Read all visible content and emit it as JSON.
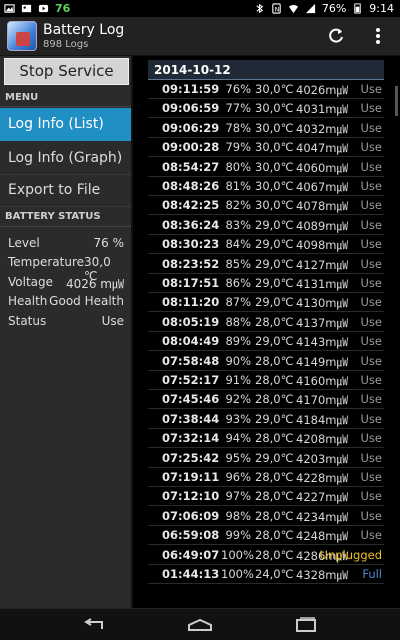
{
  "status_bar": {
    "left_number": "76",
    "battery_percent": "76%",
    "time": "9:14"
  },
  "header": {
    "title": "Battery Log",
    "subtitle": "898 Logs",
    "icons": [
      "refresh-icon",
      "overflow-menu-icon"
    ]
  },
  "drawer": {
    "stop_button": "Stop Service",
    "menu_heading": "MENU",
    "menu_items": [
      {
        "label": "Log Info (List)",
        "active": true
      },
      {
        "label": "Log Info (Graph)",
        "active": false
      },
      {
        "label": "Export to File",
        "active": false
      }
    ],
    "status_heading": "BATTERY STATUS",
    "status": [
      {
        "label": "Level",
        "value": "76 %"
      },
      {
        "label": "Temperature",
        "value": "30,0 ℃"
      },
      {
        "label": "Voltage",
        "value": "4026 m㎼"
      },
      {
        "label": "Health",
        "value": "Good Health"
      },
      {
        "label": "Status",
        "value": "Use"
      }
    ]
  },
  "log": {
    "date": "2014-10-12",
    "rows": [
      {
        "time": "09:11:59",
        "pct": "76%",
        "temp": "30,0℃",
        "volt": "4026m㎼",
        "status": "Use"
      },
      {
        "time": "09:06:59",
        "pct": "77%",
        "temp": "30,0℃",
        "volt": "4031m㎼",
        "status": "Use"
      },
      {
        "time": "09:06:29",
        "pct": "78%",
        "temp": "30,0℃",
        "volt": "4032m㎼",
        "status": "Use"
      },
      {
        "time": "09:00:28",
        "pct": "79%",
        "temp": "30,0℃",
        "volt": "4047m㎼",
        "status": "Use"
      },
      {
        "time": "08:54:27",
        "pct": "80%",
        "temp": "30,0℃",
        "volt": "4060m㎼",
        "status": "Use"
      },
      {
        "time": "08:48:26",
        "pct": "81%",
        "temp": "30,0℃",
        "volt": "4067m㎼",
        "status": "Use"
      },
      {
        "time": "08:42:25",
        "pct": "82%",
        "temp": "30,0℃",
        "volt": "4078m㎼",
        "status": "Use"
      },
      {
        "time": "08:36:24",
        "pct": "83%",
        "temp": "29,0℃",
        "volt": "4089m㎼",
        "status": "Use"
      },
      {
        "time": "08:30:23",
        "pct": "84%",
        "temp": "29,0℃",
        "volt": "4098m㎼",
        "status": "Use"
      },
      {
        "time": "08:23:52",
        "pct": "85%",
        "temp": "29,0℃",
        "volt": "4127m㎼",
        "status": "Use"
      },
      {
        "time": "08:17:51",
        "pct": "86%",
        "temp": "29,0℃",
        "volt": "4131m㎼",
        "status": "Use"
      },
      {
        "time": "08:11:20",
        "pct": "87%",
        "temp": "29,0℃",
        "volt": "4130m㎼",
        "status": "Use"
      },
      {
        "time": "08:05:19",
        "pct": "88%",
        "temp": "28,0℃",
        "volt": "4137m㎼",
        "status": "Use"
      },
      {
        "time": "08:04:49",
        "pct": "89%",
        "temp": "29,0℃",
        "volt": "4143m㎼",
        "status": "Use"
      },
      {
        "time": "07:58:48",
        "pct": "90%",
        "temp": "28,0℃",
        "volt": "4149m㎼",
        "status": "Use"
      },
      {
        "time": "07:52:17",
        "pct": "91%",
        "temp": "28,0℃",
        "volt": "4160m㎼",
        "status": "Use"
      },
      {
        "time": "07:45:46",
        "pct": "92%",
        "temp": "28,0℃",
        "volt": "4170m㎼",
        "status": "Use"
      },
      {
        "time": "07:38:44",
        "pct": "93%",
        "temp": "29,0℃",
        "volt": "4184m㎼",
        "status": "Use"
      },
      {
        "time": "07:32:14",
        "pct": "94%",
        "temp": "28,0℃",
        "volt": "4208m㎼",
        "status": "Use"
      },
      {
        "time": "07:25:42",
        "pct": "95%",
        "temp": "29,0℃",
        "volt": "4203m㎼",
        "status": "Use"
      },
      {
        "time": "07:19:11",
        "pct": "96%",
        "temp": "28,0℃",
        "volt": "4228m㎼",
        "status": "Use"
      },
      {
        "time": "07:12:10",
        "pct": "97%",
        "temp": "28,0℃",
        "volt": "4227m㎼",
        "status": "Use"
      },
      {
        "time": "07:06:09",
        "pct": "98%",
        "temp": "28,0℃",
        "volt": "4234m㎼",
        "status": "Use"
      },
      {
        "time": "06:59:08",
        "pct": "99%",
        "temp": "28,0℃",
        "volt": "4248m㎼",
        "status": "Use"
      },
      {
        "time": "06:49:07",
        "pct": "100%",
        "temp": "28,0℃",
        "volt": "4286m㎼",
        "status": "Unplugged"
      },
      {
        "time": "01:44:13",
        "pct": "100%",
        "temp": "24,0℃",
        "volt": "4328m㎼",
        "status": "Full"
      }
    ]
  },
  "nav_bar": {
    "icons": [
      "back-icon",
      "home-icon",
      "recents-icon"
    ]
  }
}
